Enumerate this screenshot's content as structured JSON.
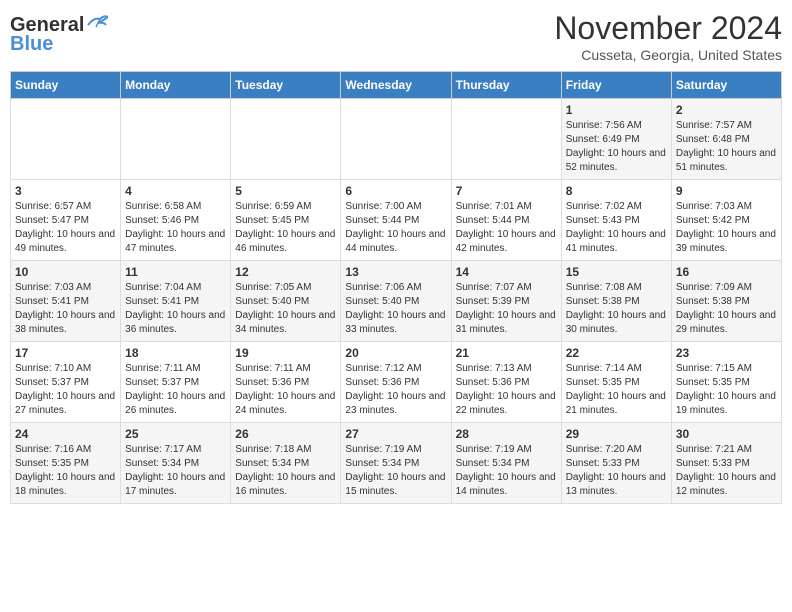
{
  "header": {
    "logo_line1": "General",
    "logo_line2": "Blue",
    "month_title": "November 2024",
    "subtitle": "Cusseta, Georgia, United States"
  },
  "days_of_week": [
    "Sunday",
    "Monday",
    "Tuesday",
    "Wednesday",
    "Thursday",
    "Friday",
    "Saturday"
  ],
  "weeks": [
    [
      {
        "day": "",
        "info": ""
      },
      {
        "day": "",
        "info": ""
      },
      {
        "day": "",
        "info": ""
      },
      {
        "day": "",
        "info": ""
      },
      {
        "day": "",
        "info": ""
      },
      {
        "day": "1",
        "info": "Sunrise: 7:56 AM\nSunset: 6:49 PM\nDaylight: 10 hours and 52 minutes."
      },
      {
        "day": "2",
        "info": "Sunrise: 7:57 AM\nSunset: 6:48 PM\nDaylight: 10 hours and 51 minutes."
      }
    ],
    [
      {
        "day": "3",
        "info": "Sunrise: 6:57 AM\nSunset: 5:47 PM\nDaylight: 10 hours and 49 minutes."
      },
      {
        "day": "4",
        "info": "Sunrise: 6:58 AM\nSunset: 5:46 PM\nDaylight: 10 hours and 47 minutes."
      },
      {
        "day": "5",
        "info": "Sunrise: 6:59 AM\nSunset: 5:45 PM\nDaylight: 10 hours and 46 minutes."
      },
      {
        "day": "6",
        "info": "Sunrise: 7:00 AM\nSunset: 5:44 PM\nDaylight: 10 hours and 44 minutes."
      },
      {
        "day": "7",
        "info": "Sunrise: 7:01 AM\nSunset: 5:44 PM\nDaylight: 10 hours and 42 minutes."
      },
      {
        "day": "8",
        "info": "Sunrise: 7:02 AM\nSunset: 5:43 PM\nDaylight: 10 hours and 41 minutes."
      },
      {
        "day": "9",
        "info": "Sunrise: 7:03 AM\nSunset: 5:42 PM\nDaylight: 10 hours and 39 minutes."
      }
    ],
    [
      {
        "day": "10",
        "info": "Sunrise: 7:03 AM\nSunset: 5:41 PM\nDaylight: 10 hours and 38 minutes."
      },
      {
        "day": "11",
        "info": "Sunrise: 7:04 AM\nSunset: 5:41 PM\nDaylight: 10 hours and 36 minutes."
      },
      {
        "day": "12",
        "info": "Sunrise: 7:05 AM\nSunset: 5:40 PM\nDaylight: 10 hours and 34 minutes."
      },
      {
        "day": "13",
        "info": "Sunrise: 7:06 AM\nSunset: 5:40 PM\nDaylight: 10 hours and 33 minutes."
      },
      {
        "day": "14",
        "info": "Sunrise: 7:07 AM\nSunset: 5:39 PM\nDaylight: 10 hours and 31 minutes."
      },
      {
        "day": "15",
        "info": "Sunrise: 7:08 AM\nSunset: 5:38 PM\nDaylight: 10 hours and 30 minutes."
      },
      {
        "day": "16",
        "info": "Sunrise: 7:09 AM\nSunset: 5:38 PM\nDaylight: 10 hours and 29 minutes."
      }
    ],
    [
      {
        "day": "17",
        "info": "Sunrise: 7:10 AM\nSunset: 5:37 PM\nDaylight: 10 hours and 27 minutes."
      },
      {
        "day": "18",
        "info": "Sunrise: 7:11 AM\nSunset: 5:37 PM\nDaylight: 10 hours and 26 minutes."
      },
      {
        "day": "19",
        "info": "Sunrise: 7:11 AM\nSunset: 5:36 PM\nDaylight: 10 hours and 24 minutes."
      },
      {
        "day": "20",
        "info": "Sunrise: 7:12 AM\nSunset: 5:36 PM\nDaylight: 10 hours and 23 minutes."
      },
      {
        "day": "21",
        "info": "Sunrise: 7:13 AM\nSunset: 5:36 PM\nDaylight: 10 hours and 22 minutes."
      },
      {
        "day": "22",
        "info": "Sunrise: 7:14 AM\nSunset: 5:35 PM\nDaylight: 10 hours and 21 minutes."
      },
      {
        "day": "23",
        "info": "Sunrise: 7:15 AM\nSunset: 5:35 PM\nDaylight: 10 hours and 19 minutes."
      }
    ],
    [
      {
        "day": "24",
        "info": "Sunrise: 7:16 AM\nSunset: 5:35 PM\nDaylight: 10 hours and 18 minutes."
      },
      {
        "day": "25",
        "info": "Sunrise: 7:17 AM\nSunset: 5:34 PM\nDaylight: 10 hours and 17 minutes."
      },
      {
        "day": "26",
        "info": "Sunrise: 7:18 AM\nSunset: 5:34 PM\nDaylight: 10 hours and 16 minutes."
      },
      {
        "day": "27",
        "info": "Sunrise: 7:19 AM\nSunset: 5:34 PM\nDaylight: 10 hours and 15 minutes."
      },
      {
        "day": "28",
        "info": "Sunrise: 7:19 AM\nSunset: 5:34 PM\nDaylight: 10 hours and 14 minutes."
      },
      {
        "day": "29",
        "info": "Sunrise: 7:20 AM\nSunset: 5:33 PM\nDaylight: 10 hours and 13 minutes."
      },
      {
        "day": "30",
        "info": "Sunrise: 7:21 AM\nSunset: 5:33 PM\nDaylight: 10 hours and 12 minutes."
      }
    ]
  ]
}
